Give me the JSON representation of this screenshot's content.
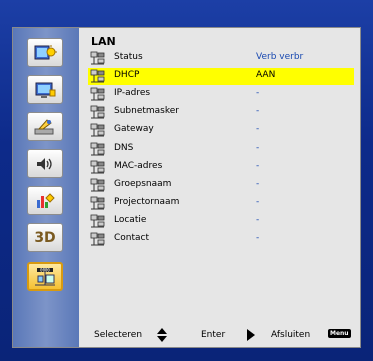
{
  "menu": {
    "title": "LAN",
    "items": [
      {
        "label": "Status",
        "value": "Verb verbr",
        "selected": false
      },
      {
        "label": "DHCP",
        "value": "AAN",
        "selected": true
      },
      {
        "label": "IP-adres",
        "value": "-",
        "selected": false
      },
      {
        "label": "Subnetmasker",
        "value": "-",
        "selected": false
      },
      {
        "label": "Gateway",
        "value": "-",
        "selected": false
      },
      {
        "label": "DNS",
        "value": "-",
        "selected": false
      },
      {
        "label": "MAC-adres",
        "value": "-",
        "selected": false
      },
      {
        "label": "Groepsnaam",
        "value": "-",
        "selected": false
      },
      {
        "label": "Projectornaam",
        "value": "-",
        "selected": false
      },
      {
        "label": "Locatie",
        "value": "-",
        "selected": false
      },
      {
        "label": "Contact",
        "value": "-",
        "selected": false
      }
    ]
  },
  "sidebar": {
    "items": [
      {
        "name": "image-settings-icon"
      },
      {
        "name": "display-settings-icon"
      },
      {
        "name": "setup-icon"
      },
      {
        "name": "volume-icon",
        "glyph": "◁))"
      },
      {
        "name": "options-icon"
      },
      {
        "name": "3d-icon",
        "text": "3D"
      },
      {
        "name": "lan-icon",
        "active": true
      }
    ]
  },
  "footer": {
    "select_label": "Selecteren",
    "enter_label": "Enter",
    "exit_label": "Afsluiten",
    "menu_key": "Menu"
  },
  "colors": {
    "highlight": "#ffff00",
    "value_text": "#1848b0",
    "frame_blue": "#1c3fa6"
  }
}
